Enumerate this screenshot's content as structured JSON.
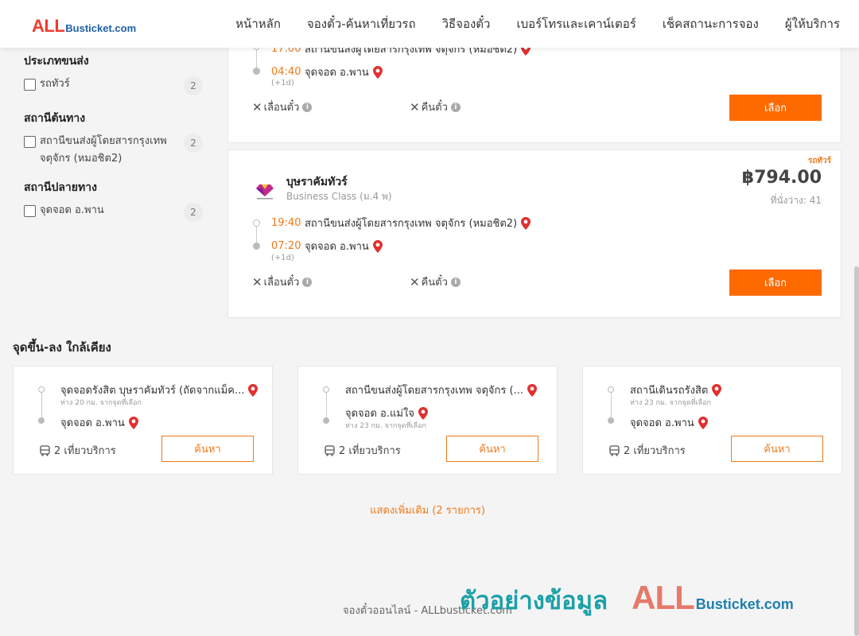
{
  "header": {
    "logo_all": "ALL",
    "logo_rest": "Busticket.com",
    "nav": [
      "หน้าหลัก",
      "จองตั๋ว-ค้นหาเที่ยวรถ",
      "วิธีจองตั๋ว",
      "เบอร์โทรและเคาน์เตอร์",
      "เช็คสถานะการจอง",
      "ผู้ให้บริการ"
    ]
  },
  "filters": {
    "transport_type": {
      "title": "ประเภทขนส่ง",
      "options": [
        {
          "label": "รถทัวร์",
          "count": "2"
        }
      ]
    },
    "origin": {
      "title": "สถานีต้นทาง",
      "options": [
        {
          "label": "สถานีขนส่งผู้โดยสารกรุงเทพ จตุจักร (หมอชิต2)",
          "count": "2"
        }
      ]
    },
    "destination": {
      "title": "สถานีปลายทาง",
      "options": [
        {
          "label": "จุดจอด อ.พาน",
          "count": "2"
        }
      ]
    }
  },
  "trips": [
    {
      "depart_time": "17:00",
      "depart_station": "สถานีขนส่งผู้โดยสารกรุงเทพ จตุจักร (หมอชิต2)",
      "arrive_time": "04:40",
      "arrive_station": "จุดจอด อ.พาน",
      "next_day": "(+1d)",
      "reschedule": "เลื่อนตั๋ว",
      "refund": "คืนตั๋ว",
      "button": "เลือก"
    },
    {
      "bus_type": "รถทัวร์",
      "operator": "บุษราคัมทัวร์",
      "class": "Business Class (ม.4 พ)",
      "price": "฿794.00",
      "seats": "ที่นั่งว่าง: 41",
      "depart_time": "19:40",
      "depart_station": "สถานีขนส่งผู้โดยสารกรุงเทพ จตุจักร (หมอชิต2)",
      "arrive_time": "07:20",
      "arrive_station": "จุดจอด อ.พาน",
      "next_day": "(+1d)",
      "reschedule": "เลื่อนตั๋ว",
      "refund": "คืนตั๋ว",
      "button": "เลือก"
    }
  ],
  "nearby": {
    "title": "จุดขึ้น-ลง ใกล้เคียง",
    "cards": [
      {
        "from": "จุดจอดรังสิต บุษราคัมทัวร์ (ถัดจากแม็ค...",
        "from_dist": "ห่าง 20 กม. จากจุดที่เลือก",
        "to": "จุดจอด อ.พาน",
        "to_dist": "",
        "trips": "2 เที่ยวบริการ",
        "button": "ค้นหา"
      },
      {
        "from": "สถานีขนส่งผู้โดยสารกรุงเทพ จตุจักร (...",
        "from_dist": "",
        "to": "จุดจอด อ.แม่ใจ",
        "to_dist": "ห่าง 23 กม. จากจุดที่เลือก",
        "trips": "2 เที่ยวบริการ",
        "button": "ค้นหา"
      },
      {
        "from": "สถานีเดินรถรังสิต",
        "from_dist": "ห่าง 23 กม. จากจุดที่เลือก",
        "to": "จุดจอด อ.พาน",
        "to_dist": "",
        "trips": "2 เที่ยวบริการ",
        "button": "ค้นหา"
      }
    ]
  },
  "show_more": "แสดงเพิ่มเติม (2 รายการ)",
  "footer": "จองตั๋วออนไลน์ - ALLbusticket.com",
  "watermark": {
    "thai": "ตัวอย่างข้อมูล",
    "all": "ALL",
    "rest": "Busticket.com"
  },
  "colors": {
    "accent": "#ff6a00",
    "brand_red": "#ef3b2c",
    "brand_blue": "#1f5fa8",
    "time_orange": "#ef7a1a"
  }
}
